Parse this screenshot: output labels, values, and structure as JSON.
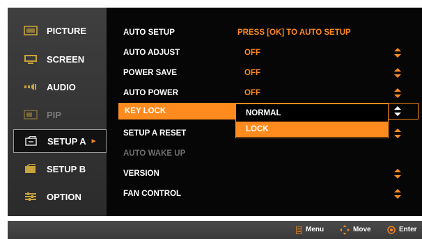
{
  "sidebar": {
    "items": [
      {
        "label": "PICTURE",
        "icon": "picture-icon"
      },
      {
        "label": "SCREEN",
        "icon": "screen-icon"
      },
      {
        "label": "AUDIO",
        "icon": "audio-icon"
      },
      {
        "label": "PIP",
        "icon": "pip-icon"
      },
      {
        "label": "SETUP A",
        "icon": "setup-a-icon"
      },
      {
        "label": "SETUP B",
        "icon": "setup-b-icon"
      },
      {
        "label": "OPTION",
        "icon": "option-icon"
      }
    ],
    "active_arrow": "►"
  },
  "menu": {
    "rows": [
      {
        "label": "AUTO SETUP",
        "value": "PRESS [OK] TO AUTO SETUP"
      },
      {
        "label": "AUTO ADJUST",
        "value": "OFF"
      },
      {
        "label": "POWER SAVE",
        "value": "OFF"
      },
      {
        "label": "AUTO POWER",
        "value": "OFF"
      },
      {
        "label": "KEY LOCK",
        "value": ""
      },
      {
        "label": "SETUP A RESET",
        "value": ""
      },
      {
        "label": "AUTO WAKE UP",
        "value": ""
      },
      {
        "label": "VERSION",
        "value": ""
      },
      {
        "label": "FAN CONTROL",
        "value": ""
      }
    ]
  },
  "dropdown": {
    "options": [
      "NORMAL",
      "LOCK"
    ],
    "selected": "LOCK"
  },
  "footer": {
    "menu": "Menu",
    "move": "Move",
    "enter": "Enter"
  },
  "colors": {
    "accent": "#ff8a1e",
    "background": "#060606",
    "sidebar": "#363636"
  }
}
